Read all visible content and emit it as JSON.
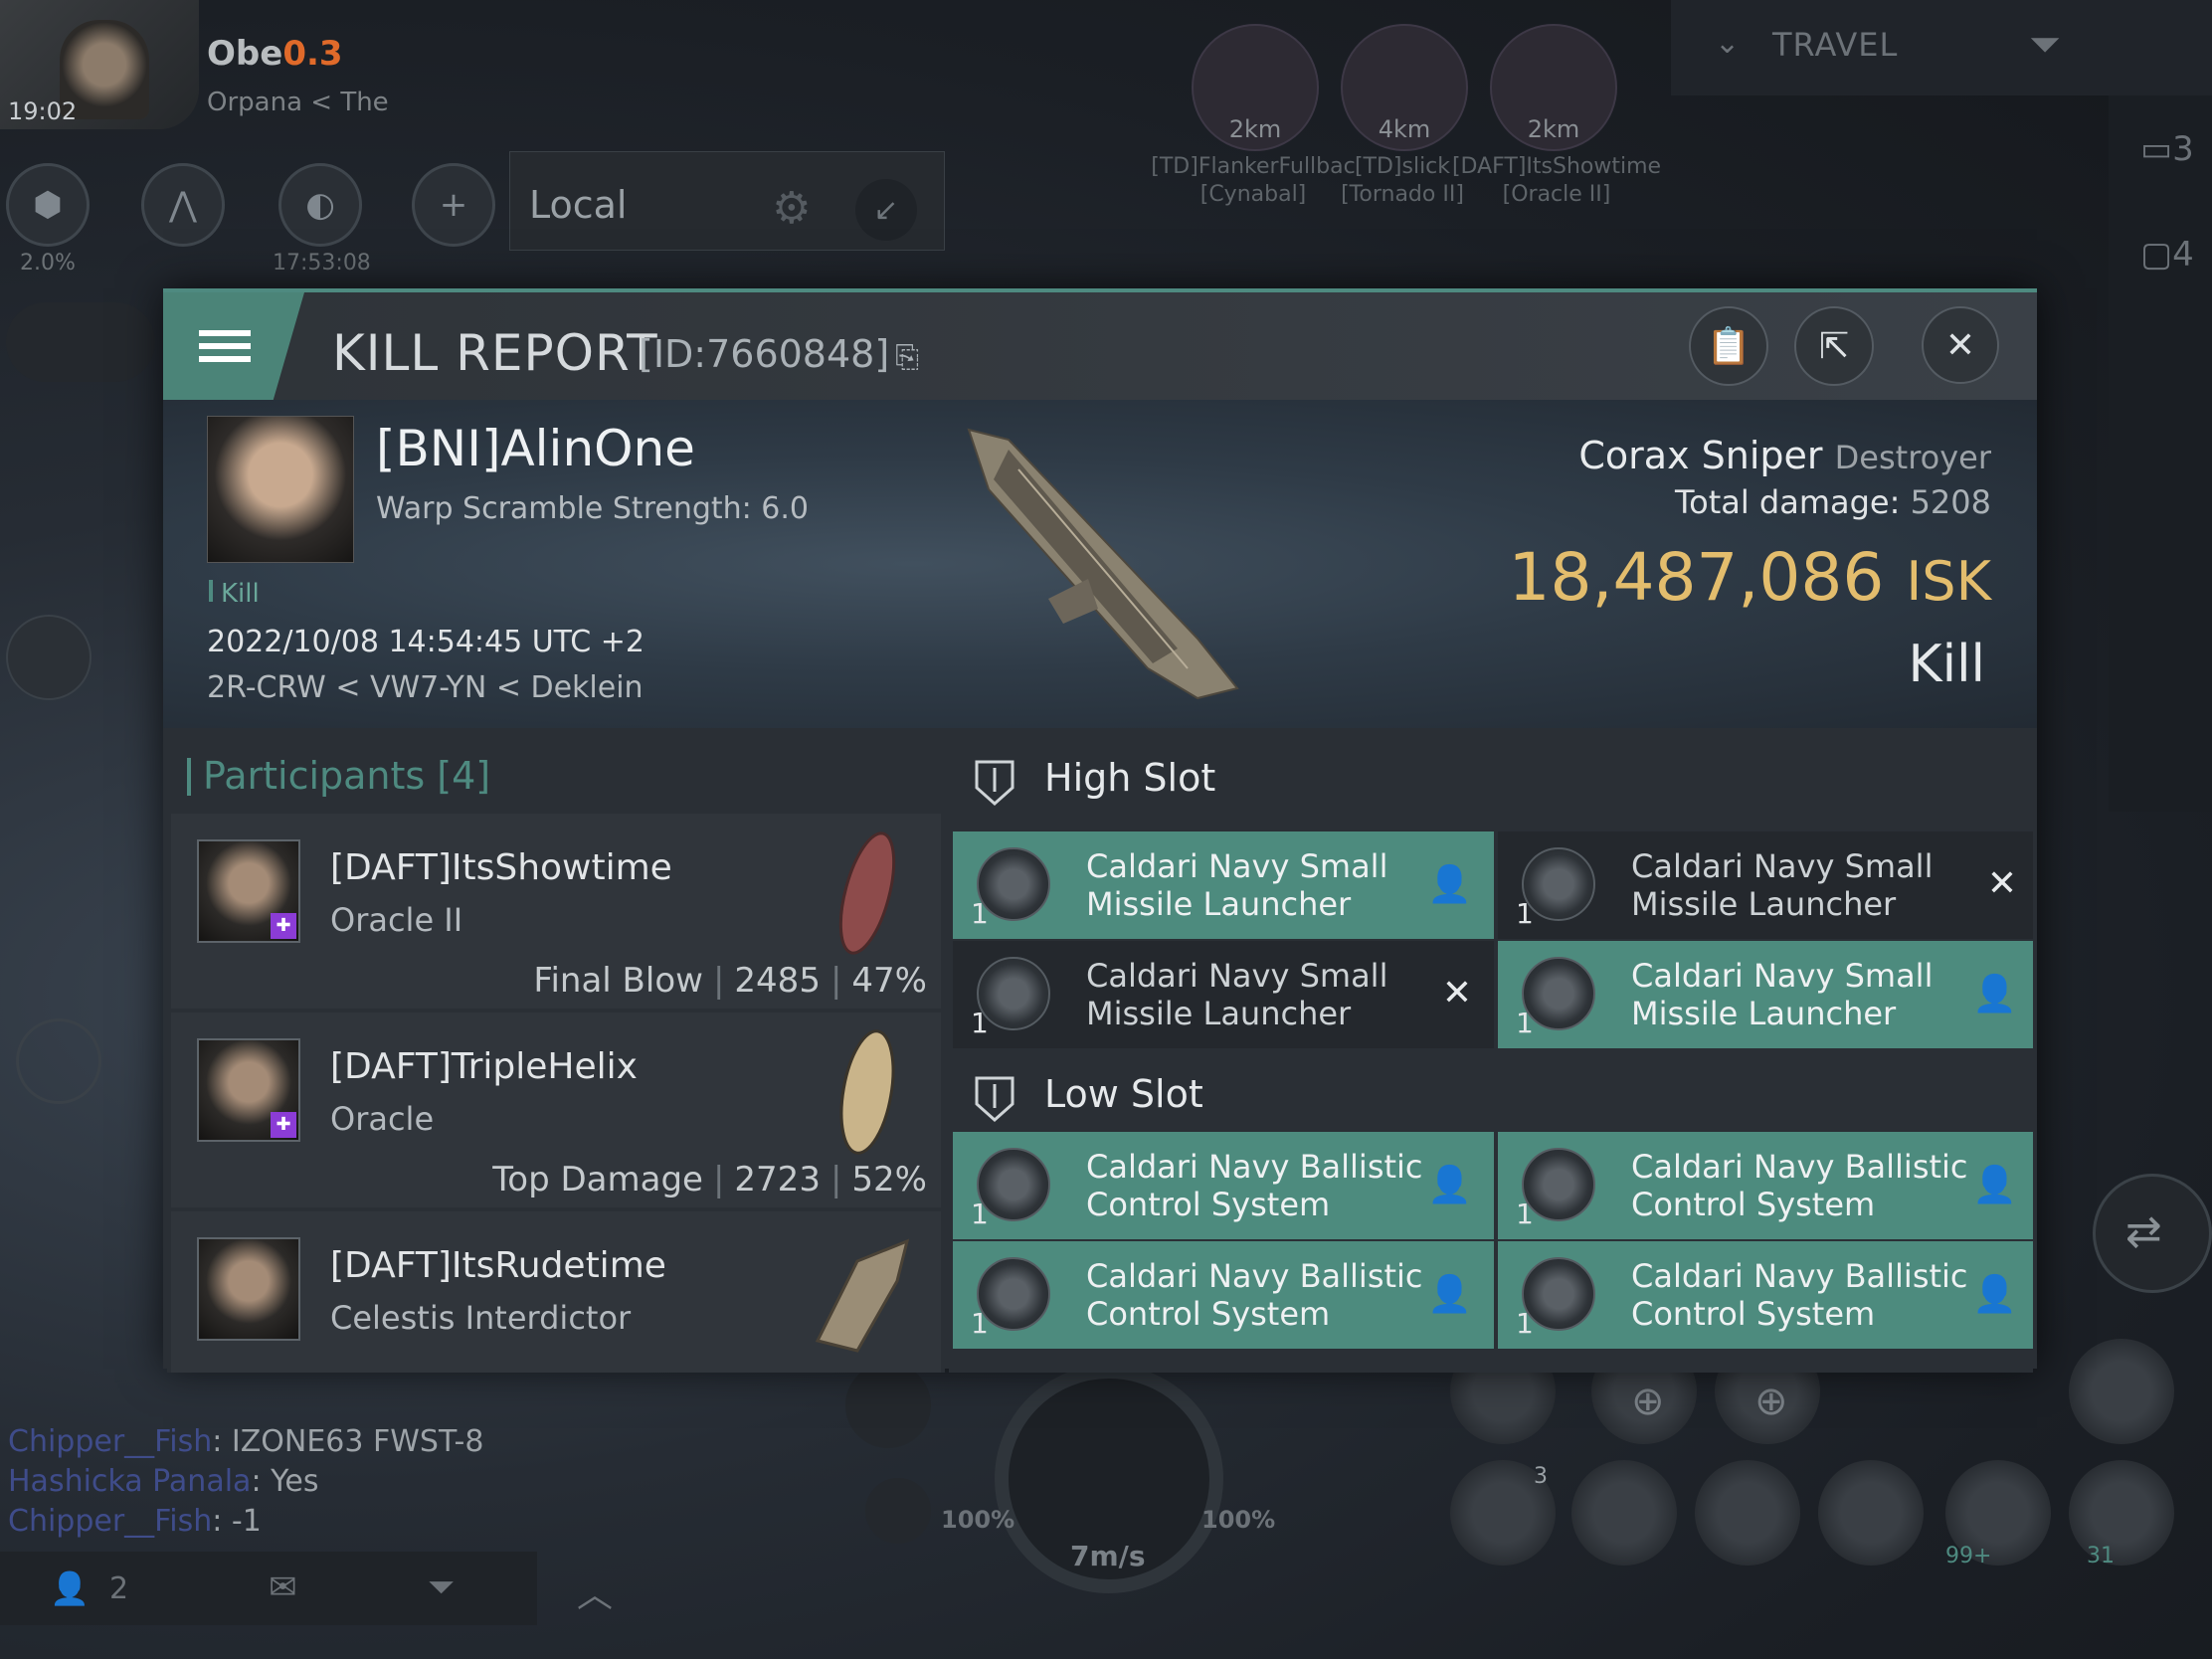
{
  "hud": {
    "clock": "19:02",
    "pilot_name": "Obe",
    "security": "0.3",
    "location": "Orpana < The",
    "stat_percent": "2.0%",
    "session_time": "17:53:08",
    "local_title": "Local",
    "travel_label": "TRAVEL",
    "right_counts": [
      "3",
      "4"
    ]
  },
  "overview": [
    {
      "distance": "2km",
      "label": "[TD]FlankerFullbac",
      "ship": "[Cynabal]"
    },
    {
      "distance": "4km",
      "label": "[TD]slick",
      "ship": "[Tornado II]"
    },
    {
      "distance": "2km",
      "label": "[DAFT]ItsShowtime",
      "ship": "[Oracle II]"
    }
  ],
  "kill_report": {
    "title": "KILL REPORT",
    "id": "[ID:7660848]",
    "victim": {
      "name": "[BNI]AlinOne",
      "scram": "Warp Scramble Strength: 6.0",
      "kill_tag": "Kill",
      "datetime": "2022/10/08 14:54:45 UTC +2",
      "system": "2R-CRW < VW7-YN < Deklein"
    },
    "ship_name": "Corax Sniper",
    "ship_class": "Destroyer",
    "total_damage_label": "Total damage:",
    "total_damage": "5208",
    "isk_value": "18,487,086",
    "isk_unit": "ISK",
    "result": "Kill",
    "participants_title": "Participants [4]",
    "participants": [
      {
        "name": "[DAFT]ItsShowtime",
        "ship": "Oracle II",
        "tag": "Final Blow",
        "damage": "2485",
        "percent": "47%"
      },
      {
        "name": "[DAFT]TripleHelix",
        "ship": "Oracle",
        "tag": "Top Damage",
        "damage": "2723",
        "percent": "52%"
      },
      {
        "name": "[DAFT]ItsRudetime",
        "ship": "Celestis Interdictor",
        "tag": "",
        "damage": "",
        "percent": ""
      }
    ],
    "high_slot_title": "High Slot",
    "low_slot_title": "Low Slot",
    "high_slots": [
      {
        "line1": "Caldari Navy Small",
        "line2": "Missile Launcher",
        "qty": "1",
        "state": "dropped"
      },
      {
        "line1": "Caldari Navy Small",
        "line2": "Missile Launcher",
        "qty": "1",
        "state": "destroyed"
      },
      {
        "line1": "Caldari Navy Small",
        "line2": "Missile Launcher",
        "qty": "1",
        "state": "destroyed"
      },
      {
        "line1": "Caldari Navy Small",
        "line2": "Missile Launcher",
        "qty": "1",
        "state": "dropped"
      }
    ],
    "low_slots": [
      {
        "line1": "Caldari Navy Ballistic",
        "line2": "Control System",
        "qty": "1",
        "state": "dropped"
      },
      {
        "line1": "Caldari Navy Ballistic",
        "line2": "Control System",
        "qty": "1",
        "state": "dropped"
      },
      {
        "line1": "Caldari Navy Ballistic",
        "line2": "Control System",
        "qty": "1",
        "state": "dropped"
      },
      {
        "line1": "Caldari Navy Ballistic",
        "line2": "Control System",
        "qty": "1",
        "state": "dropped"
      }
    ]
  },
  "chat": [
    {
      "who": "Chipper__Fish",
      "text": ": IZONE63  FWST-8"
    },
    {
      "who": "Hashicka Panala",
      "text": ": Yes"
    },
    {
      "who": "Chipper__Fish",
      "text": ": -1"
    }
  ],
  "bottom": {
    "people_count": "2",
    "speed": "7m/s",
    "left_pct": "100%",
    "right_pct": "100%",
    "module_badge_1": "3",
    "module_badge_2": "99+",
    "module_badge_3": "31"
  },
  "colors": {
    "accent": "#4e8a80",
    "isk": "#e3bd6d",
    "security": "#e06a2a"
  }
}
